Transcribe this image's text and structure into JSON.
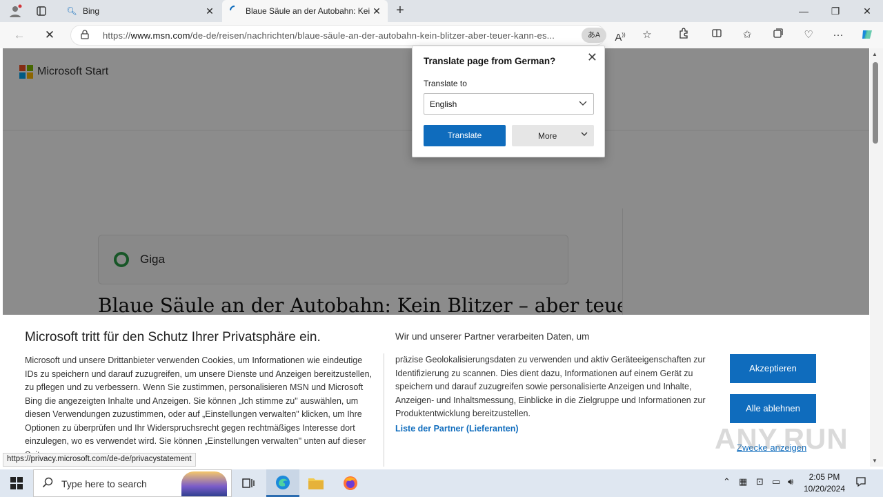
{
  "browser": {
    "tabs": [
      {
        "title": "Bing",
        "active": false
      },
      {
        "title": "Blaue Säule an der Autobahn: Kein",
        "active": true
      }
    ],
    "address": {
      "url_prefix": "https://",
      "url_domain": "www.msn.com",
      "url_rest": "/de-de/reisen/nachrichten/blaue-säule-an-der-autobahn-kein-blitzer-aber-teuer-kann-es...",
      "translate_badge": "あA"
    }
  },
  "page": {
    "logo_text": "Microsoft Start",
    "source_name": "Giga",
    "headline": "Blaue Säule an der Autobahn: Kein Blitzer – aber teuer"
  },
  "translate_popup": {
    "title": "Translate page from German?",
    "label": "Translate to",
    "selected_language": "English",
    "translate_button": "Translate",
    "more_button": "More"
  },
  "consent": {
    "title": "Microsoft tritt für den Schutz Ihrer Privatsphäre ein.",
    "left_text": "Microsoft und unsere Drittanbieter verwenden Cookies, um Informationen wie eindeutige IDs zu speichern und darauf zuzugreifen, um unsere Dienste und Anzeigen bereitzustellen, zu pflegen und zu verbessern. Wenn Sie zustimmen, personalisieren MSN und Microsoft Bing die angezeigten Inhalte und Anzeigen. Sie können „Ich stimme zu\" auswählen, um diesen Verwendungen zuzustimmen, oder auf „Einstellungen verwalten\" klicken, um Ihre Optionen zu überprüfen und Ihr Widerspruchsrecht gegen rechtmäßiges Interesse dort einzulegen, wo es verwendet wird. Sie können „Einstellungen verwalten\" unten auf dieser Seite",
    "right_title": "Wir und unserer Partner verarbeiten Daten, um",
    "right_text": "präzise Geolokalisierungsdaten zu verwenden und aktiv Geräteeigenschaften zur Identifizierung zu scannen. Dies dient dazu, Informationen auf einem Gerät zu speichern und darauf zuzugreifen sowie personalisierte Anzeigen und Inhalte, Anzeigen- und Inhaltsmessung, Einblicke in die Zielgruppe und Informationen zur Produktentwicklung bereitzustellen.",
    "partner_link": "Liste der Partner (Lieferanten)",
    "accept_button": "Akzeptieren",
    "reject_button": "Alle ablehnen",
    "purposes_link": "Zwecke anzeigen"
  },
  "status_link": "https://privacy.microsoft.com/de-de/privacystatement",
  "watermark": "ANY.RUN",
  "taskbar": {
    "search_placeholder": "Type here to search",
    "time": "2:05 PM",
    "date": "10/20/2024"
  }
}
